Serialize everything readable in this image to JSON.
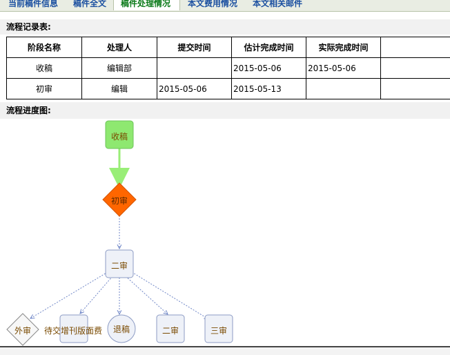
{
  "tabs": [
    {
      "label": "当前稿件信息",
      "active": false
    },
    {
      "label": "稿件全文",
      "active": false
    },
    {
      "label": "稿件处理情况",
      "active": true
    },
    {
      "label": "本文费用情况",
      "active": false
    },
    {
      "label": "本文相关邮件",
      "active": false
    }
  ],
  "record_section": {
    "title": "流程记录表:"
  },
  "table": {
    "headers": [
      "阶段名称",
      "处理人",
      "提交时间",
      "估计完成时间",
      "实际完成时间",
      ""
    ],
    "rows": [
      [
        "收稿",
        "编辑部",
        "",
        "2015-05-06",
        "2015-05-06",
        ""
      ],
      [
        "初审",
        "编辑",
        "2015-05-06",
        "2015-05-13",
        "",
        ""
      ]
    ]
  },
  "progress_section": {
    "title": "流程进度图:"
  },
  "diagram": {
    "nodes": {
      "shougao": "收稿",
      "chushen": "初审",
      "ershen": "二审",
      "waishen": "外审",
      "daijiao": "待交增刊版面费",
      "tuigao": "退稿",
      "ershen2": "二审",
      "sanshen": "三审"
    },
    "colors": {
      "completed": "#8ee870",
      "current": "#ff6600",
      "pending": "#eef1f8",
      "edge": "#6f86c7",
      "done_edge": "#99ee77"
    }
  }
}
